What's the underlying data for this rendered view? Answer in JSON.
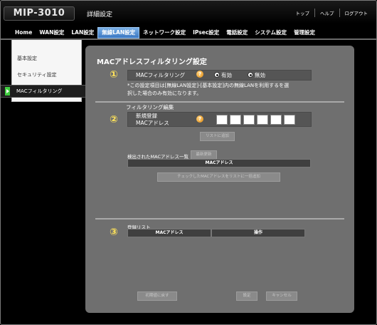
{
  "header": {
    "logo": "MIP-3010",
    "subtitle": "詳細設定",
    "links": [
      "トップ",
      "ヘルプ",
      "ログアウト"
    ]
  },
  "tabs": [
    "Home",
    "WAN設定",
    "LAN設定",
    "無線LAN設定",
    "ネットワーク設定",
    "IPsec設定",
    "電話設定",
    "システム設定",
    "管理設定"
  ],
  "active_tab": "無線LAN設定",
  "sidebar": {
    "items": [
      "基本設定",
      "セキュリティ設定",
      "MACフィルタリング"
    ],
    "active": "MACフィルタリング"
  },
  "main": {
    "title": "MACアドレスフィルタリング設定",
    "section1": {
      "number": "①",
      "label": "MACフィルタリング",
      "help": "?",
      "options": [
        "有効",
        "無効"
      ],
      "selected": "無効",
      "note_line1": "*この設定項目は[無線LAN設定]-[基本設定]内の無線LANを利用するを選",
      "note_line2": "択した場合のみ有効になります。"
    },
    "section2": {
      "number": "②",
      "heading": "フィルタリング編集",
      "label_line1": "新規登録",
      "label_line2": "MACアドレス",
      "help": "?",
      "mac_fields": [
        "",
        "",
        "",
        "",
        "",
        ""
      ],
      "add_button": "リストに追加",
      "detected_label": "検出されたMACアドレス一覧",
      "refresh_button": "最新更新",
      "column_header": "MACアドレス",
      "add_checked_button": "チェックしたMACアドレスをリストに一括追加"
    },
    "section3": {
      "number": "③",
      "heading": "登録リスト",
      "columns": [
        "MACアドレス",
        "操作"
      ]
    },
    "buttons": {
      "reset": "初期値に戻す",
      "save": "設定",
      "cancel": "キャンセル"
    }
  }
}
